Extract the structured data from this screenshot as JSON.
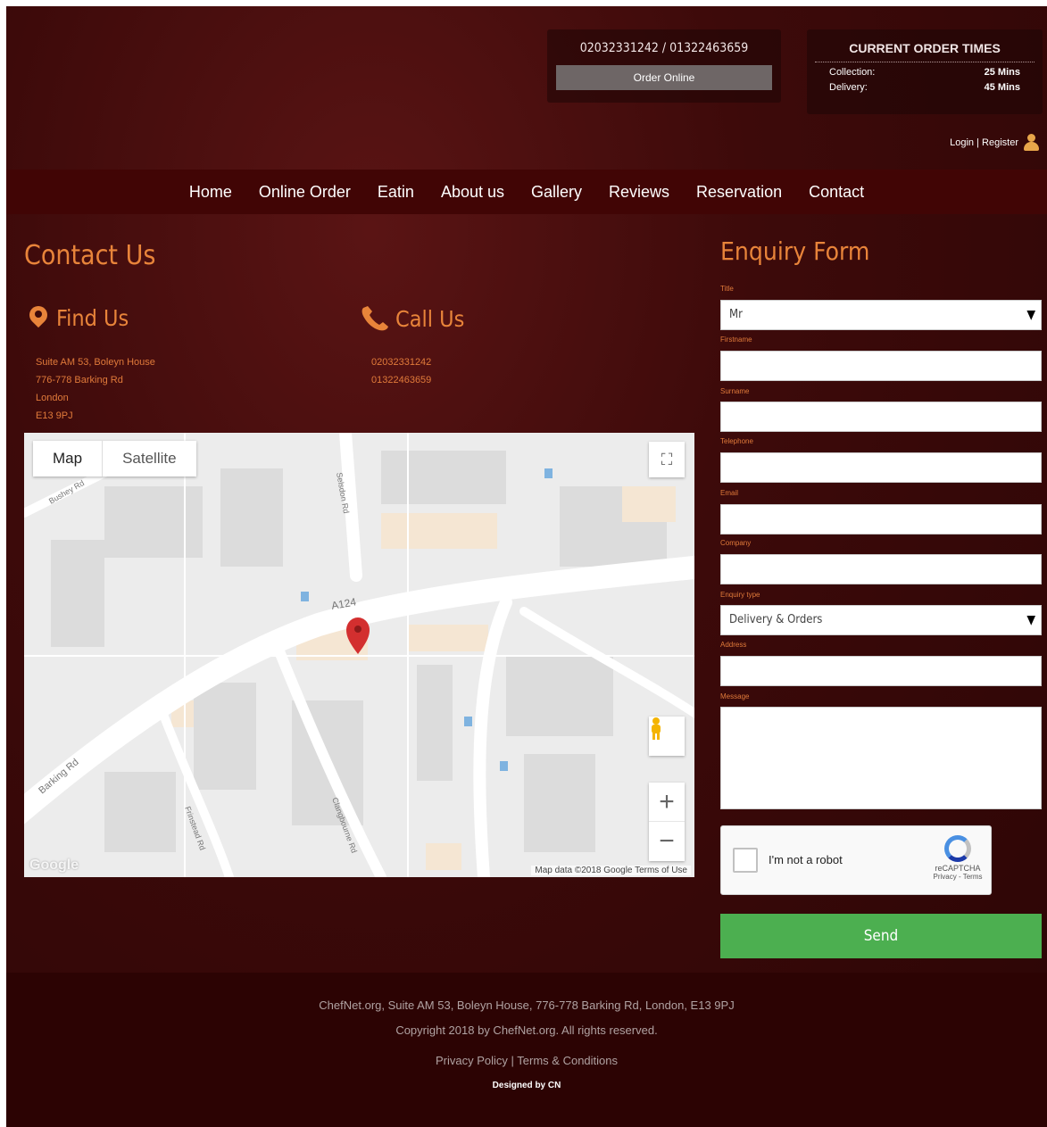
{
  "header": {
    "phones": "02032331242 / 01322463659",
    "order_online": "Order Online",
    "times_title": "CURRENT ORDER TIMES",
    "collection_label": "Collection:",
    "collection_value": "25 Mins",
    "delivery_label": "Delivery:",
    "delivery_value": "45 Mins",
    "login": "Login",
    "register": "Register",
    "separator": "|"
  },
  "nav": {
    "items": [
      {
        "label": "Home"
      },
      {
        "label": "Online Order"
      },
      {
        "label": "Eatin"
      },
      {
        "label": "About us"
      },
      {
        "label": "Gallery"
      },
      {
        "label": "Reviews"
      },
      {
        "label": "Reservation"
      },
      {
        "label": "Contact"
      }
    ]
  },
  "contact": {
    "title": "Contact Us",
    "find_title": "Find Us",
    "call_title": "Call Us",
    "address_lines": [
      "Suite AM 53, Boleyn House",
      "776-778 Barking Rd",
      "London",
      "E13 9PJ"
    ],
    "phones": [
      "02032331242",
      "01322463659"
    ]
  },
  "map": {
    "tab_map": "Map",
    "tab_satellite": "Satellite",
    "footer": "Map data ©2018 Google   Terms of Use",
    "google": "Google",
    "road_labels": [
      "A124",
      "Barking Rd",
      "Selsdon Rd",
      "Bushey Rd",
      "Frinstead Rd",
      "Clangbourne Rd"
    ]
  },
  "form": {
    "title": "Enquiry Form",
    "labels": {
      "title": "Title",
      "firstname": "Firstname",
      "surname": "Surname",
      "telephone": "Telephone",
      "email": "Email",
      "company": "Company",
      "enquiry_type": "Enquiry type",
      "address": "Address",
      "message": "Message"
    },
    "title_value": "Mr",
    "enquiry_value": "Delivery & Orders",
    "captcha_text": "I'm not a robot",
    "captcha_brand": "reCAPTCHA",
    "captcha_links": "Privacy - Terms",
    "send": "Send"
  },
  "footer": {
    "line1": "ChefNet.org, Suite AM 53, Boleyn House, 776-778 Barking Rd, London, E13 9PJ",
    "line2": "Copyright 2018 by ChefNet.org. All rights reserved.",
    "privacy": "Privacy Policy",
    "terms": "Terms & Conditions",
    "sep": "|",
    "designed": "Designed by CN"
  },
  "colors": {
    "accent": "#e8843a",
    "nav_bg": "#410505",
    "send_bg": "#4caf50",
    "map_pin": "#d32f2f"
  }
}
